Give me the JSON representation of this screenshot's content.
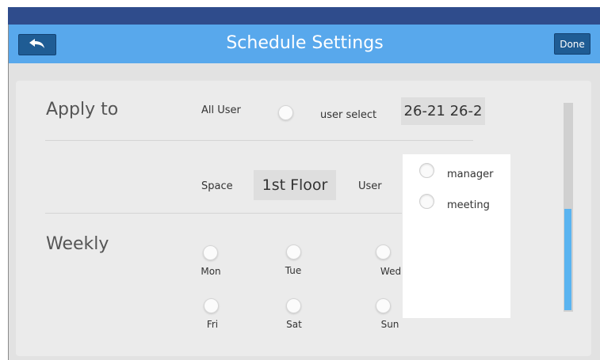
{
  "header": {
    "title": "Schedule Settings",
    "back_icon": "undo-arrow-icon",
    "done_label": "Done"
  },
  "apply_to": {
    "section_label": "Apply to",
    "all_user_label": "All User",
    "user_select_label": "user select",
    "user_select_value": "26-21 26-2"
  },
  "space": {
    "space_label": "Space",
    "space_value": "1st Floor",
    "user_label": "User"
  },
  "user_dropdown": {
    "options": [
      "manager",
      "meeting"
    ]
  },
  "weekly": {
    "section_label": "Weekly",
    "days_row1": [
      "Mon",
      "Tue",
      "Wed"
    ],
    "days_row2": [
      "Fri",
      "Sat",
      "Sun"
    ]
  },
  "colors": {
    "accent": "#58a8ec",
    "button": "#1f5c94",
    "scrollbar_thumb": "#5ab4f0"
  }
}
